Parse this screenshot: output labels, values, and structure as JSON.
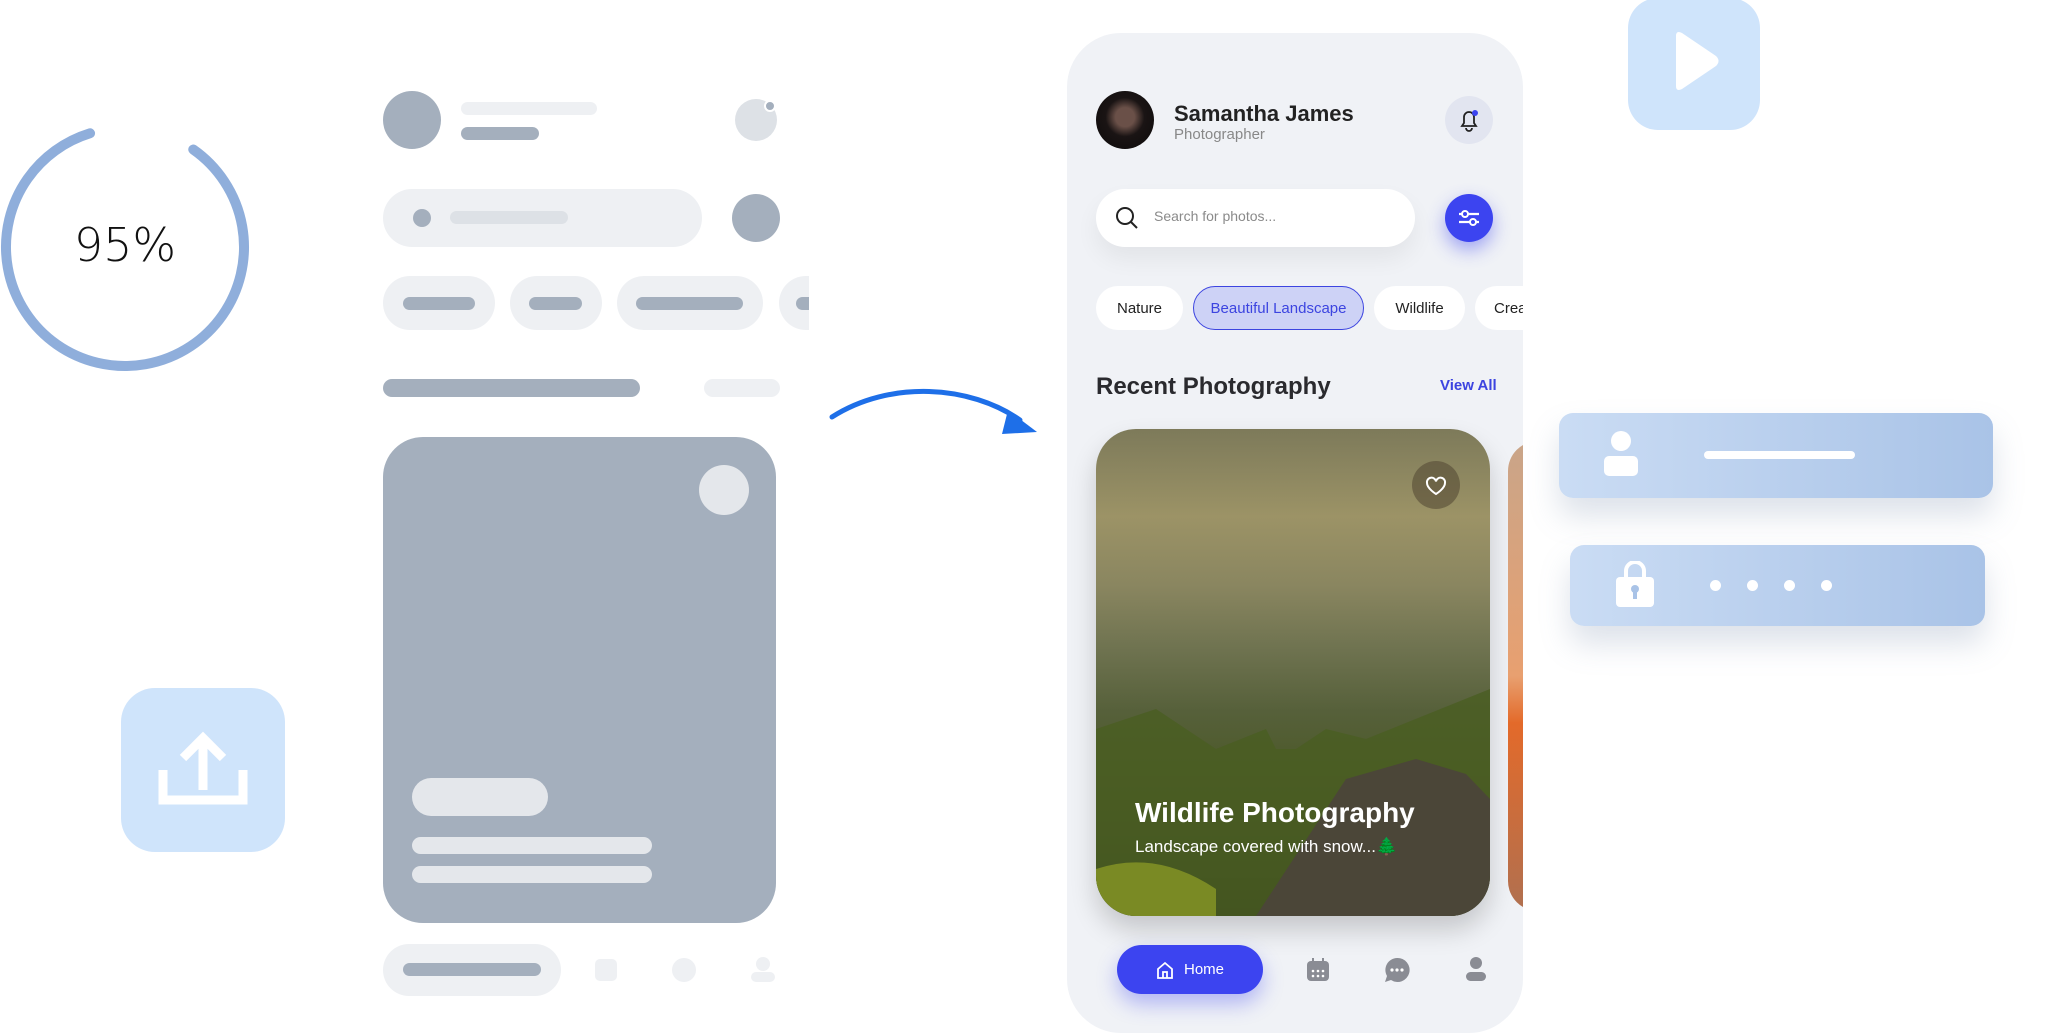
{
  "progress": {
    "label": "95%",
    "value": 95,
    "color": "#8FAEDB"
  },
  "profile": {
    "name": "Samantha James",
    "role": "Photographer"
  },
  "search": {
    "placeholder": "Search for photos..."
  },
  "chips": [
    {
      "label": "Nature",
      "active": false
    },
    {
      "label": "Beautiful Landscape",
      "active": true
    },
    {
      "label": "Wildlife",
      "active": false
    },
    {
      "label": "Crea",
      "active": false
    }
  ],
  "section": {
    "title": "Recent Photography",
    "view_all": "View All"
  },
  "card": {
    "title": "Wildlife Photography",
    "subtitle": "Landscape covered with snow...",
    "emoji": "🌲"
  },
  "nav": {
    "home": "Home"
  },
  "colors": {
    "accent": "#3C44F0",
    "skeleton_light": "#EEF0F3",
    "skeleton_dark": "#A4AFBD",
    "soft_blue": "#CFE4FB"
  }
}
